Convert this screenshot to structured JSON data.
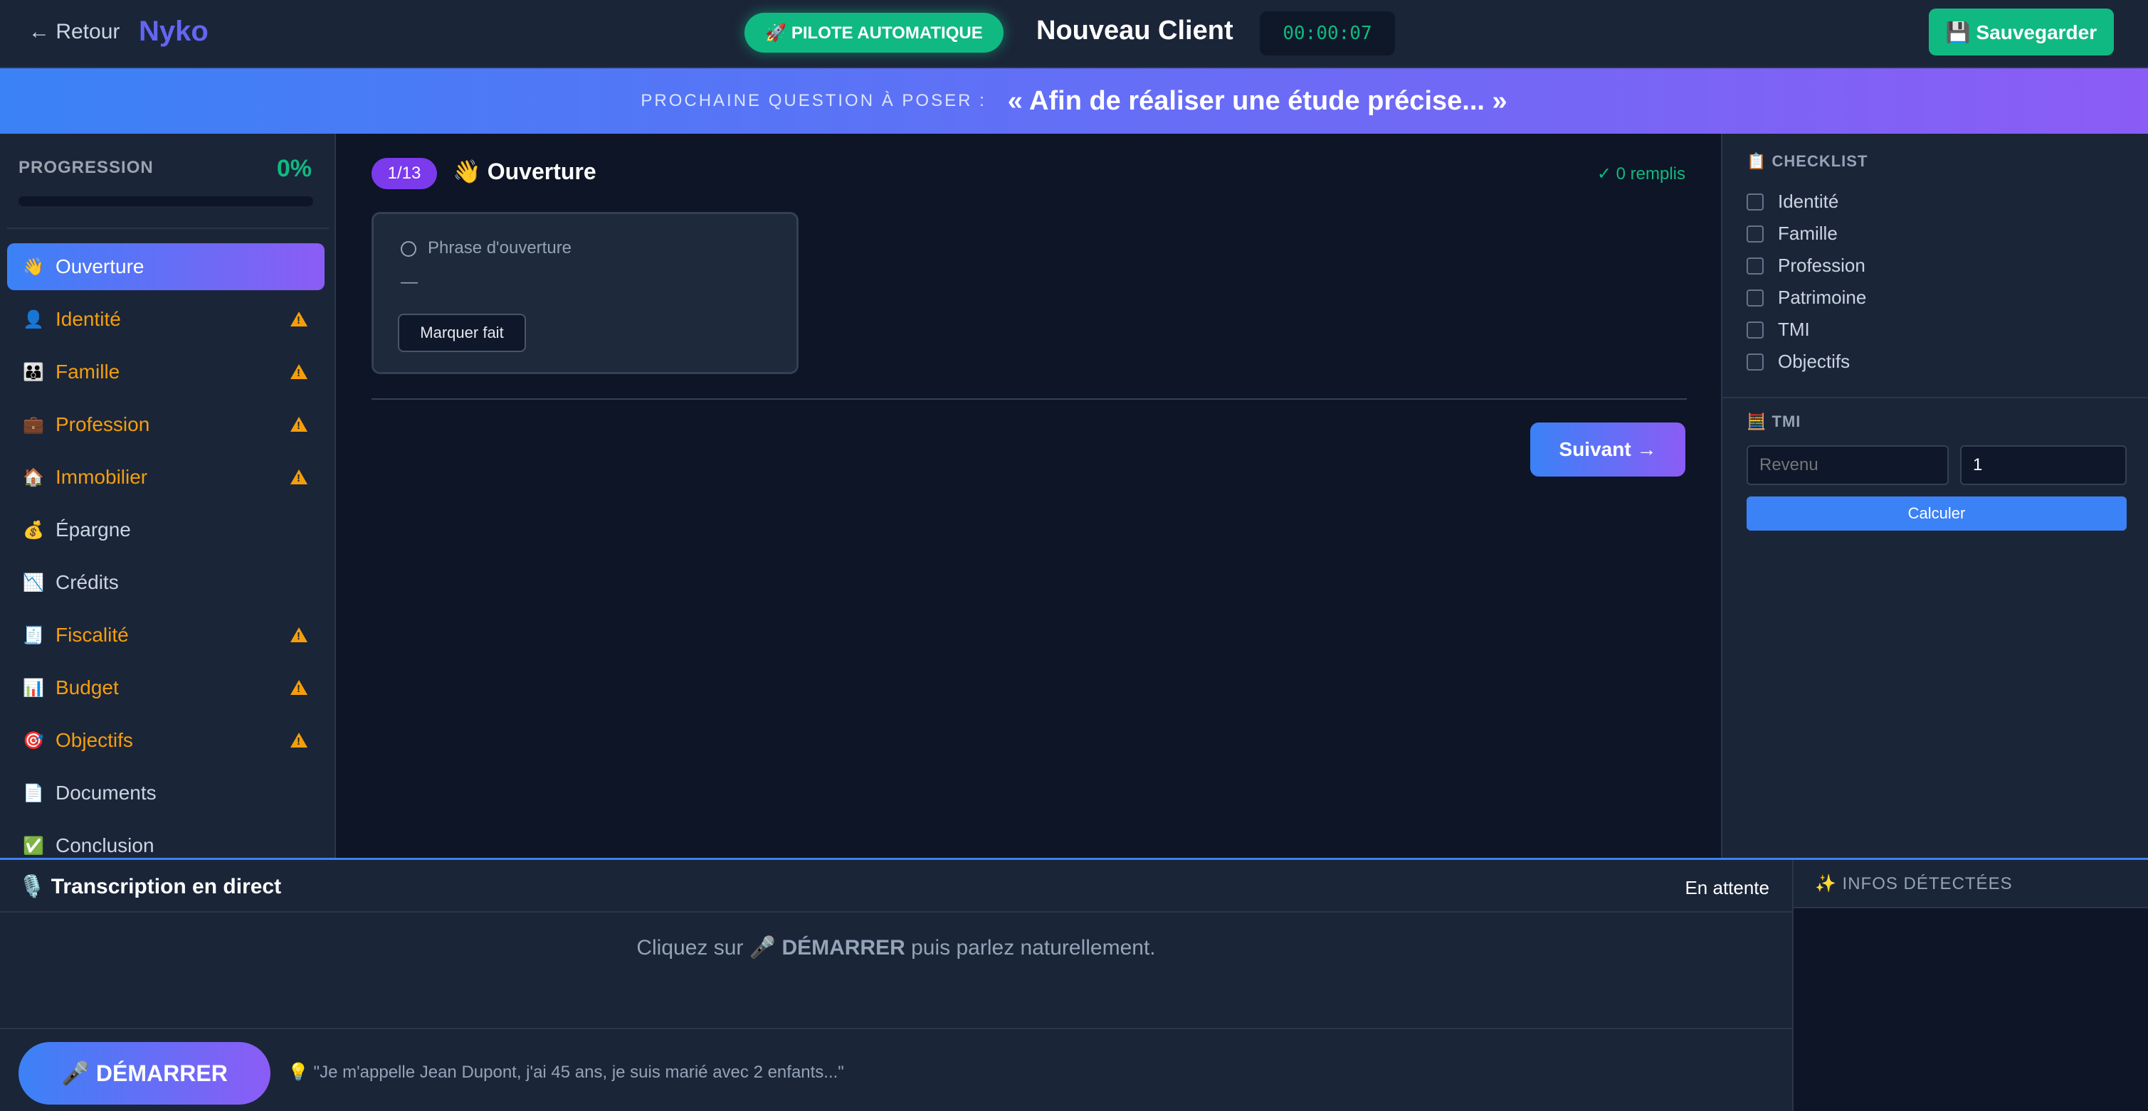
{
  "topbar": {
    "back_label": "← Retour",
    "brand": "Nyko",
    "pilot_label": "🚀 PILOTE AUTOMATIQUE",
    "client_name": "Nouveau Client",
    "timer": "00:00:07",
    "save_label": "💾 Sauvegarder"
  },
  "banner": {
    "label": "PROCHAINE QUESTION À POSER :",
    "question": "« Afin de réaliser une étude précise... »"
  },
  "progress": {
    "label": "PROGRESSION",
    "value": "0%",
    "fraction": 0
  },
  "sections": [
    {
      "icon": "👋",
      "label": "Ouverture",
      "state": "active"
    },
    {
      "icon": "👤",
      "label": "Identité",
      "state": "warn"
    },
    {
      "icon": "👪",
      "label": "Famille",
      "state": "warn"
    },
    {
      "icon": "💼",
      "label": "Profession",
      "state": "warn"
    },
    {
      "icon": "🏠",
      "label": "Immobilier",
      "state": "warn"
    },
    {
      "icon": "💰",
      "label": "Épargne",
      "state": "normal"
    },
    {
      "icon": "📉",
      "label": "Crédits",
      "state": "normal"
    },
    {
      "icon": "🧾",
      "label": "Fiscalité",
      "state": "warn"
    },
    {
      "icon": "📊",
      "label": "Budget",
      "state": "warn"
    },
    {
      "icon": "🎯",
      "label": "Objectifs",
      "state": "warn"
    },
    {
      "icon": "📄",
      "label": "Documents",
      "state": "normal"
    },
    {
      "icon": "✅",
      "label": "Conclusion",
      "state": "normal"
    }
  ],
  "main": {
    "step": "1/13",
    "title": "👋 Ouverture",
    "filled": "✓ 0 remplis",
    "field_label": "Phrase d'ouverture",
    "field_value": "—",
    "mark_done": "Marquer fait",
    "next_label": "Suivant →"
  },
  "checklist": {
    "title": "📋 CHECKLIST",
    "items": [
      "Identité",
      "Famille",
      "Profession",
      "Patrimoine",
      "TMI",
      "Objectifs"
    ]
  },
  "tmi": {
    "title": "🧮 TMI",
    "revenue_placeholder": "Revenu",
    "parts_value": "1",
    "calc_label": "Calculer"
  },
  "transcription": {
    "title": "🎙️ Transcription en direct",
    "status": "En attente",
    "instruction_pre": "Cliquez sur 🎤 ",
    "instruction_bold": "DÉMARRER",
    "instruction_post": " puis parlez naturellement.",
    "start_label": "🎤 DÉMARRER",
    "hint": "💡 \"Je m'appelle Jean Dupont, j'ai 45 ans, je suis marié avec 2 enfants...\""
  },
  "infos": {
    "title": "✨ INFOS DÉTECTÉES"
  },
  "colors": {
    "accent_green": "#10b981",
    "accent_blue": "#3b82f6",
    "accent_purple": "#8b5cf6",
    "warning": "#f59e0b"
  }
}
